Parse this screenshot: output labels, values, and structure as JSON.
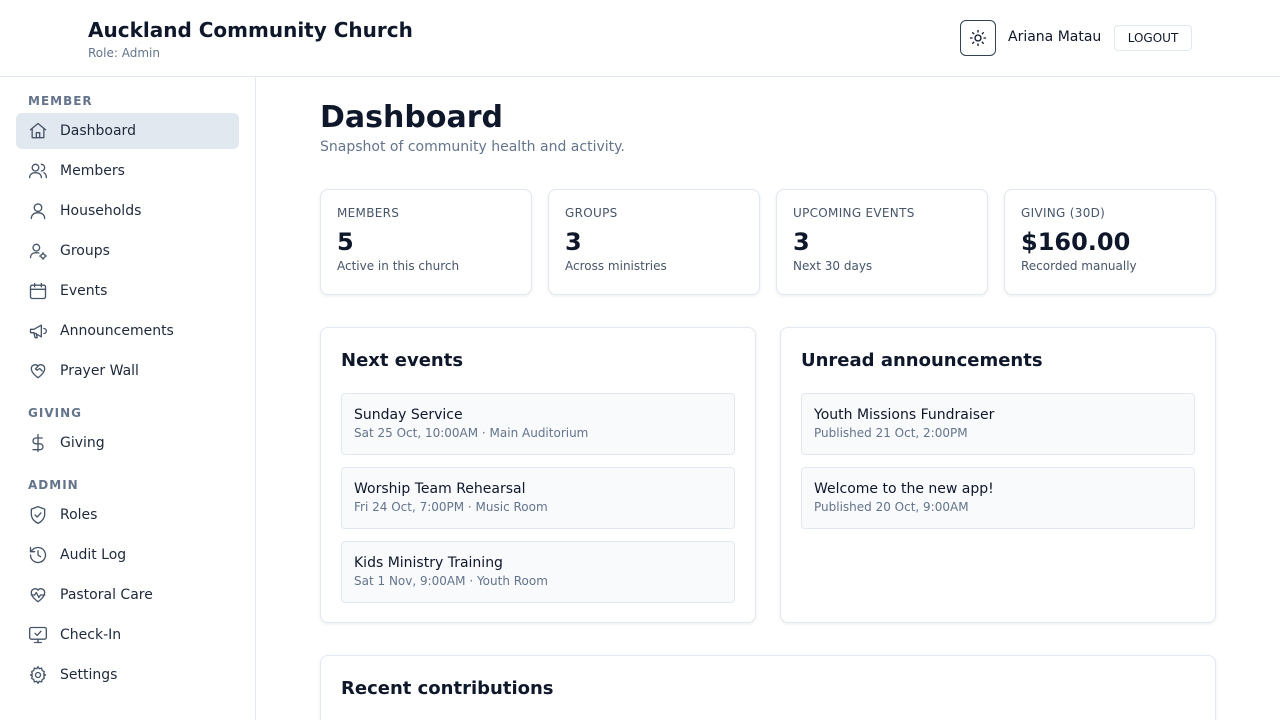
{
  "header": {
    "title": "Auckland Community Church",
    "role": "Role: Admin",
    "user_name": "Ariana Matau",
    "logout_label": "LOGOUT",
    "theme_icon": "sun-icon"
  },
  "sidebar": {
    "sections": [
      {
        "label": "MEMBER"
      },
      {
        "label": "GIVING"
      },
      {
        "label": "ADMIN"
      }
    ],
    "items": [
      {
        "label": "Dashboard",
        "icon": "home-icon",
        "active": true
      },
      {
        "label": "Members",
        "icon": "users-icon"
      },
      {
        "label": "Households",
        "icon": "user-icon"
      },
      {
        "label": "Groups",
        "icon": "user-cog-icon"
      },
      {
        "label": "Events",
        "icon": "calendar-icon"
      },
      {
        "label": "Announcements",
        "icon": "megaphone-icon"
      },
      {
        "label": "Prayer Wall",
        "icon": "heart-handshake-icon"
      },
      {
        "label": "Giving",
        "icon": "dollar-icon"
      },
      {
        "label": "Roles",
        "icon": "shield-icon"
      },
      {
        "label": "Audit Log",
        "icon": "history-icon"
      },
      {
        "label": "Pastoral Care",
        "icon": "heart-pulse-icon"
      },
      {
        "label": "Check-In",
        "icon": "monitor-check-icon"
      },
      {
        "label": "Settings",
        "icon": "gear-icon"
      }
    ]
  },
  "main": {
    "title": "Dashboard",
    "subtitle": "Snapshot of community health and activity.",
    "stats": [
      {
        "label": "MEMBERS",
        "value": "5",
        "caption": "Active in this church"
      },
      {
        "label": "GROUPS",
        "value": "3",
        "caption": "Across ministries"
      },
      {
        "label": "UPCOMING EVENTS",
        "value": "3",
        "caption": "Next 30 days"
      },
      {
        "label": "GIVING (30D)",
        "value": "$160.00",
        "caption": "Recorded manually"
      }
    ],
    "next_events": {
      "title": "Next events",
      "items": [
        {
          "title": "Sunday Service",
          "sub": "Sat 25 Oct, 10:00AM · Main Auditorium"
        },
        {
          "title": "Worship Team Rehearsal",
          "sub": "Fri 24 Oct, 7:00PM · Music Room"
        },
        {
          "title": "Kids Ministry Training",
          "sub": "Sat 1 Nov, 9:00AM · Youth Room"
        }
      ]
    },
    "announcements": {
      "title": "Unread announcements",
      "items": [
        {
          "title": "Youth Missions Fundraiser",
          "sub": "Published 21 Oct, 2:00PM"
        },
        {
          "title": "Welcome to the new app!",
          "sub": "Published 20 Oct, 9:00AM"
        }
      ]
    },
    "recent_contributions": {
      "title": "Recent contributions"
    }
  }
}
